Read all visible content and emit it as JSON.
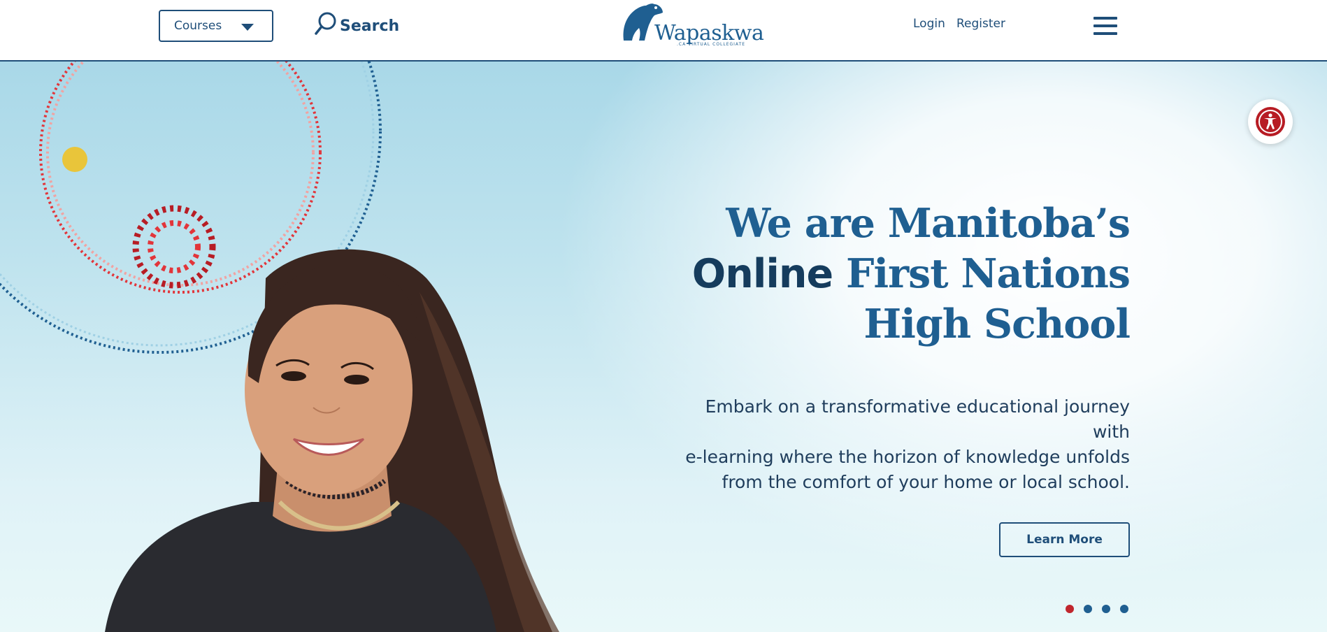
{
  "header": {
    "courses_dropdown": {
      "selected": "Courses"
    },
    "search_label": "Search",
    "logo": {
      "name": "Wapaskwa",
      "tagline": ".CA VIRTUAL COLLEGIATE"
    },
    "login_label": "Login",
    "register_label": "Register",
    "menu_icon": "hamburger-icon"
  },
  "hero": {
    "headline": {
      "line1": "We are Manitoba’s",
      "line2_bold": "Online",
      "line2_rest": "First Nations",
      "line3": "High School"
    },
    "subtext_lines": [
      "Embark on a transformative educational journey with",
      "e-learning where the horizon of knowledge unfolds",
      "from the comfort of your home or local school."
    ],
    "cta_label": "Learn More",
    "carousel": {
      "slides": 4,
      "active_index": 0
    },
    "accessibility_icon": "accessibility-icon"
  },
  "colors": {
    "brand_blue": "#1f5f91",
    "navy": "#153c5d",
    "accent_red": "#c0262d",
    "accent_yellow": "#e9c53a",
    "sky": "#a9d8e8"
  }
}
